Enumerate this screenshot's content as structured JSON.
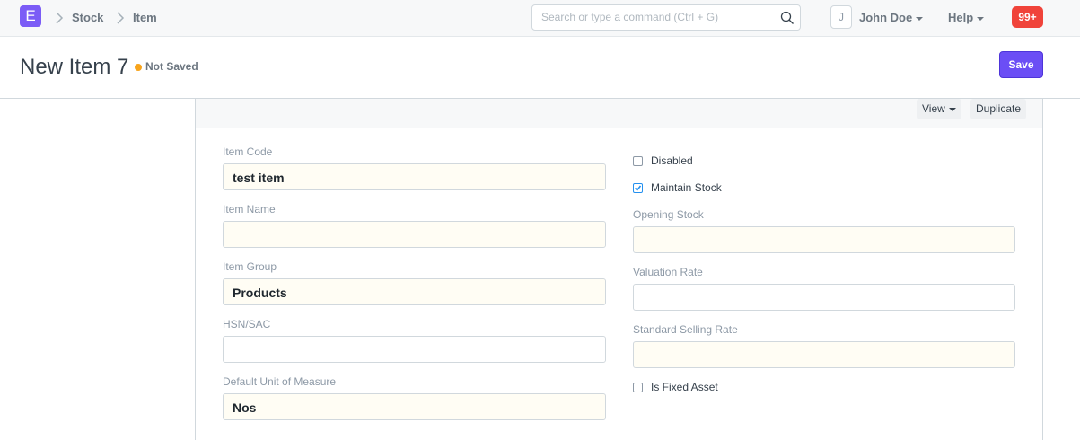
{
  "navbar": {
    "logo_letter": "E",
    "breadcrumbs": [
      "Stock",
      "Item"
    ],
    "search_placeholder": "Search or type a command (Ctrl + G)",
    "avatar_initial": "J",
    "user_name": "John Doe",
    "help_label": "Help",
    "notification_count": "99+"
  },
  "page": {
    "title": "New Item 7",
    "status": "Not Saved",
    "save_label": "Save"
  },
  "toolbar": {
    "view_label": "View",
    "duplicate_label": "Duplicate"
  },
  "form": {
    "left": [
      {
        "label": "Item Code",
        "value": "test item",
        "mandatory": true
      },
      {
        "label": "Item Name",
        "value": "",
        "mandatory": true
      },
      {
        "label": "Item Group",
        "value": "Products",
        "mandatory": true
      },
      {
        "label": "HSN/SAC",
        "value": "",
        "mandatory": false
      },
      {
        "label": "Default Unit of Measure",
        "value": "Nos",
        "mandatory": true
      }
    ],
    "disabled_label": "Disabled",
    "disabled_checked": false,
    "maintain_stock_label": "Maintain Stock",
    "maintain_stock_checked": true,
    "opening_stock_label": "Opening Stock",
    "opening_stock_value": "",
    "valuation_rate_label": "Valuation Rate",
    "valuation_rate_value": "",
    "standard_selling_rate_label": "Standard Selling Rate",
    "standard_selling_rate_value": "",
    "is_fixed_asset_label": "Is Fixed Asset",
    "is_fixed_asset_checked": false
  },
  "colors": {
    "accent": "#6b4ef5",
    "mandatory_bg": "#fffdf4",
    "status_dot": "#f8a41c",
    "notification": "#f0433a"
  }
}
